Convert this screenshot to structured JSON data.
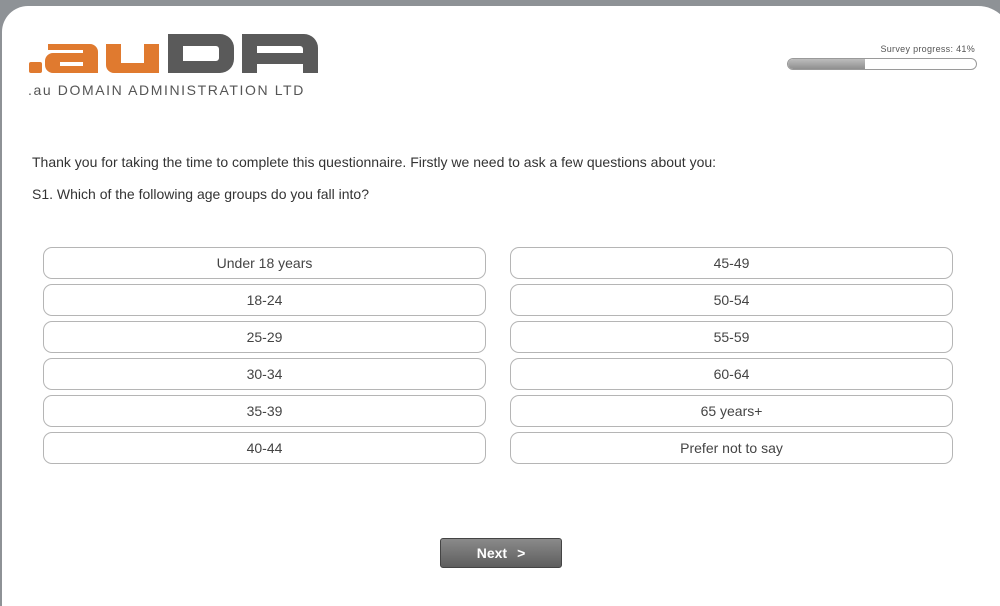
{
  "brand": {
    "logo_text": ".auDA",
    "subtitle": ".au DOMAIN ADMINISTRATION LTD",
    "colors": {
      "orange": "#e07a2f",
      "gray": "#5a5a5a"
    }
  },
  "progress": {
    "label": "Survey progress: 41%",
    "fraction": 0.41
  },
  "intro": "Thank you for taking the time to complete this questionnaire. Firstly we need to ask a few questions about you:",
  "question": "S1. Which of the following age groups do you fall into?",
  "options": [
    "Under 18 years",
    "45-49",
    "18-24",
    "50-54",
    "25-29",
    "55-59",
    "30-34",
    "60-64",
    "35-39",
    "65 years+",
    "40-44",
    "Prefer not to say"
  ],
  "next_button": {
    "label": "Next",
    "icon": "chevron-right-icon",
    "glyph": ">"
  }
}
